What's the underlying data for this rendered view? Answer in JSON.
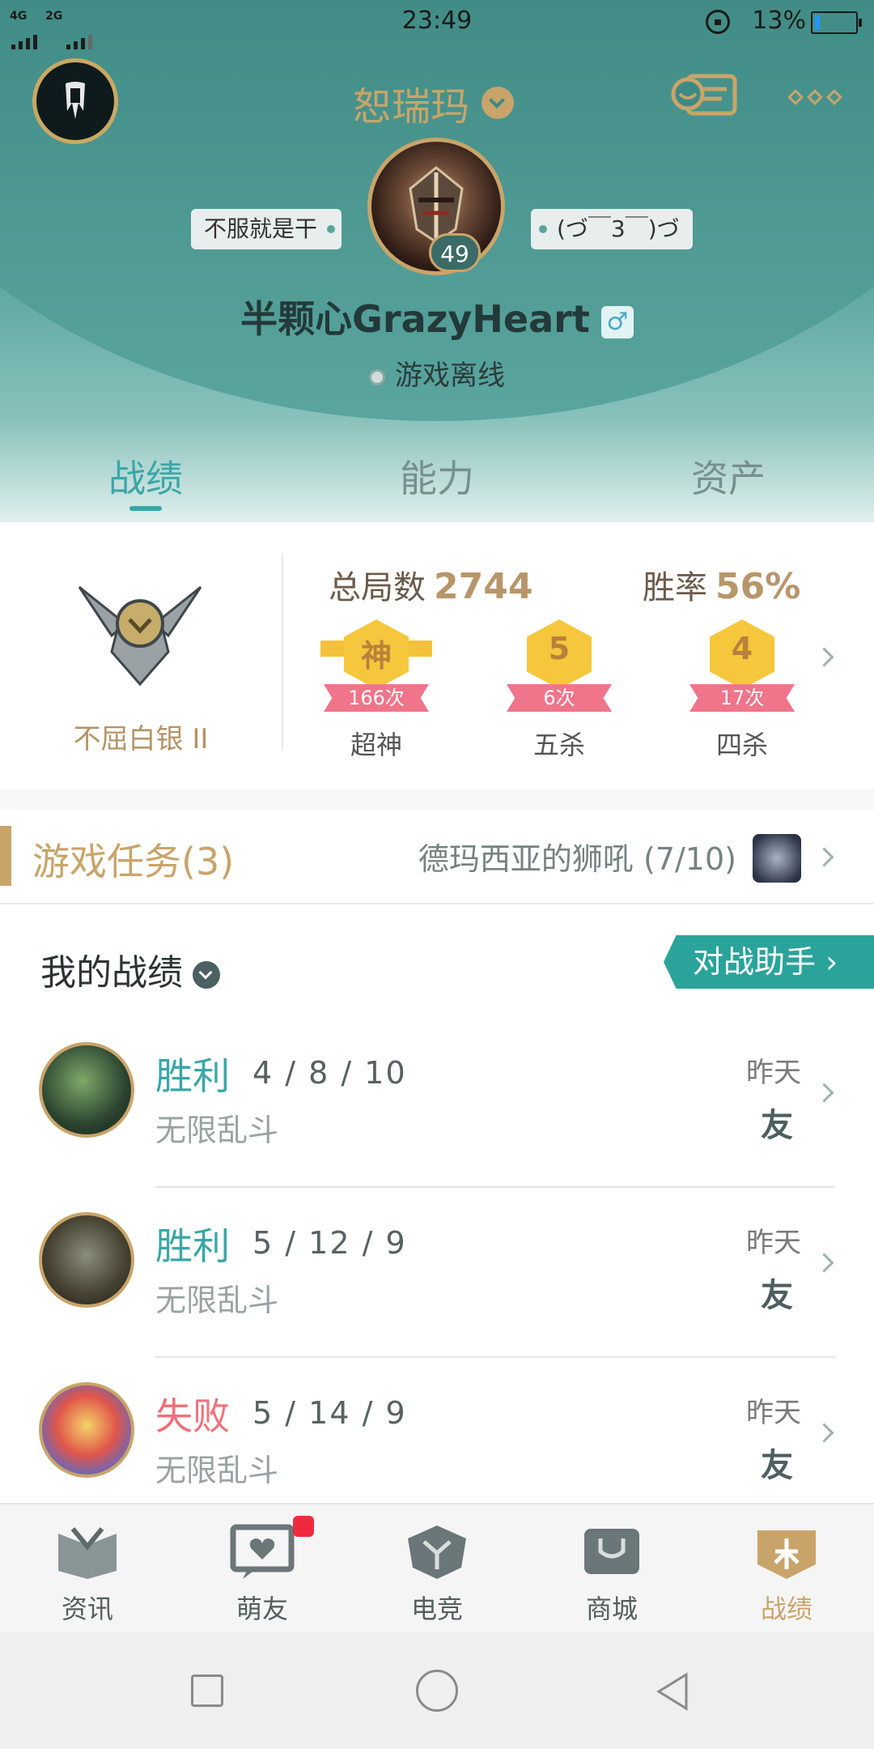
{
  "status_bar": {
    "network_left": "4G",
    "network_right": "2G",
    "time": "23:49",
    "battery_pct": "13%",
    "battery_level": 0.13
  },
  "header": {
    "nickname": "恕瑞玛",
    "level": "49",
    "tag_left": "不服就是干",
    "tag_right": "(づ￣3￣)づ",
    "username": "半颗心GrazyHeart",
    "gender_icon": "♂",
    "online_status": "游戏离线"
  },
  "tabs": [
    {
      "label": "战绩",
      "active": true
    },
    {
      "label": "能力",
      "active": false
    },
    {
      "label": "资产",
      "active": false
    }
  ],
  "rank": {
    "tier": "不屈白银 II",
    "total_games_label": "总局数",
    "total_games": "2744",
    "win_rate_label": "胜率",
    "win_rate": "56%",
    "medals": [
      {
        "symbol": "神",
        "count": "166次",
        "label": "超神"
      },
      {
        "symbol": "5",
        "count": "6次",
        "label": "五杀"
      },
      {
        "symbol": "4",
        "count": "17次",
        "label": "四杀"
      }
    ]
  },
  "task": {
    "title": "游戏任务(3)",
    "desc": "德玛西亚的狮吼 (7/10)"
  },
  "records": {
    "title": "我的战绩",
    "assist_button": "对战助手",
    "matches": [
      {
        "result": "胜利",
        "kda": "4 / 8 / 10",
        "mode": "无限乱斗",
        "when": "昨天",
        "tag": "友",
        "outcome": "win"
      },
      {
        "result": "胜利",
        "kda": "5 / 12 / 9",
        "mode": "无限乱斗",
        "when": "昨天",
        "tag": "友",
        "outcome": "win"
      },
      {
        "result": "失败",
        "kda": "5 / 14 / 9",
        "mode": "无限乱斗",
        "when": "昨天",
        "tag": "友",
        "outcome": "loss"
      }
    ]
  },
  "nav": [
    {
      "label": "资讯",
      "icon": "news-icon"
    },
    {
      "label": "萌友",
      "icon": "friends-icon"
    },
    {
      "label": "电竞",
      "icon": "esports-icon"
    },
    {
      "label": "商城",
      "icon": "store-icon"
    },
    {
      "label": "战绩",
      "icon": "records-icon"
    }
  ],
  "colors": {
    "accent": "#3aa7a6",
    "gold": "#c9a46a",
    "loss": "#f0707a"
  }
}
